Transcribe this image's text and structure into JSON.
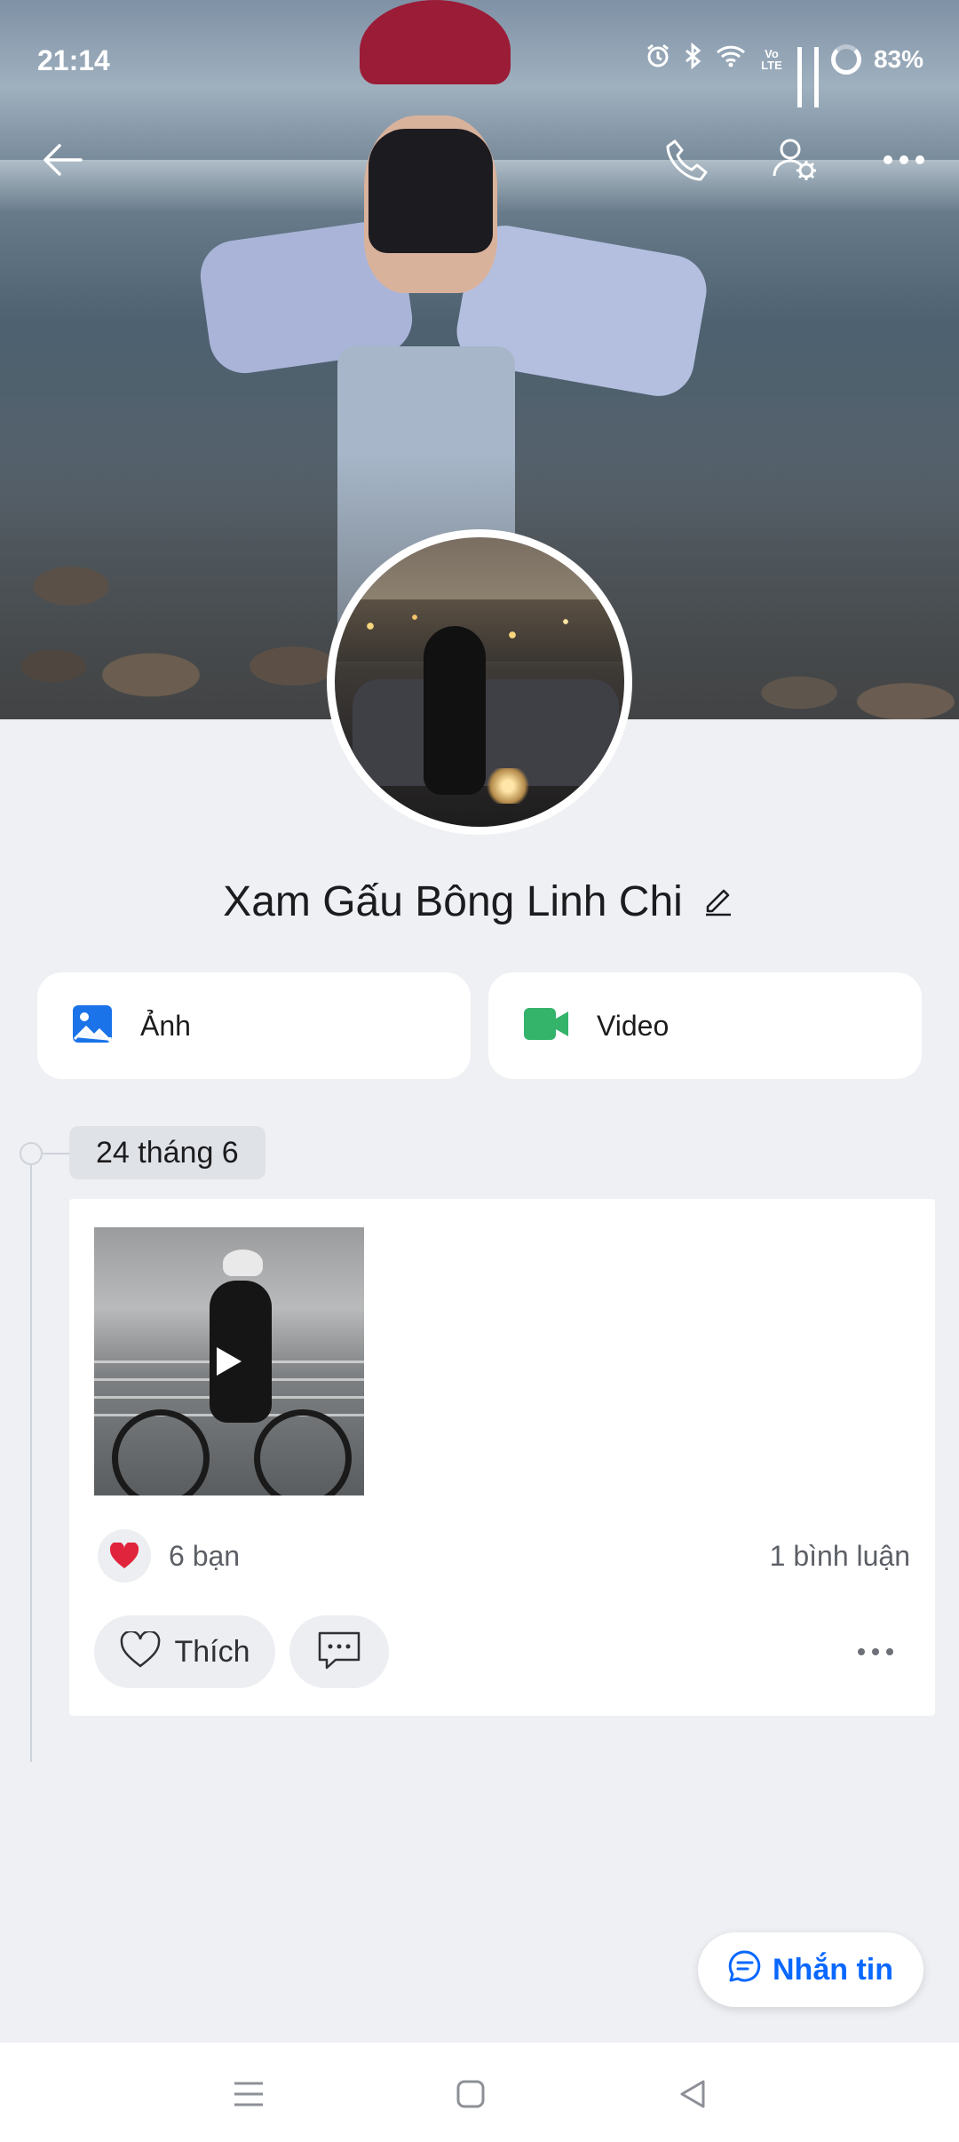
{
  "status_bar": {
    "time": "21:14",
    "battery": "83%",
    "icons": [
      "alarm-icon",
      "bluetooth-icon",
      "wifi-icon",
      "volte-icon",
      "signal-icon",
      "signal-icon",
      "battery-icon"
    ],
    "volte_label": "Vo LTE"
  },
  "header": {
    "actions": [
      "back-arrow-icon",
      "phone-call-icon",
      "profile-settings-icon",
      "more-options-icon"
    ]
  },
  "profile": {
    "name": "Xam Gấu Bông Linh Chi",
    "edit_icon": "pencil-icon"
  },
  "media_tabs": [
    {
      "label": "Ảnh",
      "icon": "image-icon",
      "color": "#1a73e8"
    },
    {
      "label": "Video",
      "icon": "video-camera-icon",
      "color": "#34b36b"
    }
  ],
  "timeline": {
    "date": "24 tháng 6",
    "post": {
      "type": "video",
      "reactions": {
        "icon": "heart-icon",
        "label": "6 bạn"
      },
      "comments": "1 bình luận",
      "actions": {
        "like_label": "Thích"
      }
    }
  },
  "message_button": {
    "label": "Nhắn tin",
    "color": "#0a68ff"
  },
  "nav": [
    "recent-apps-icon",
    "home-icon",
    "back-icon"
  ]
}
